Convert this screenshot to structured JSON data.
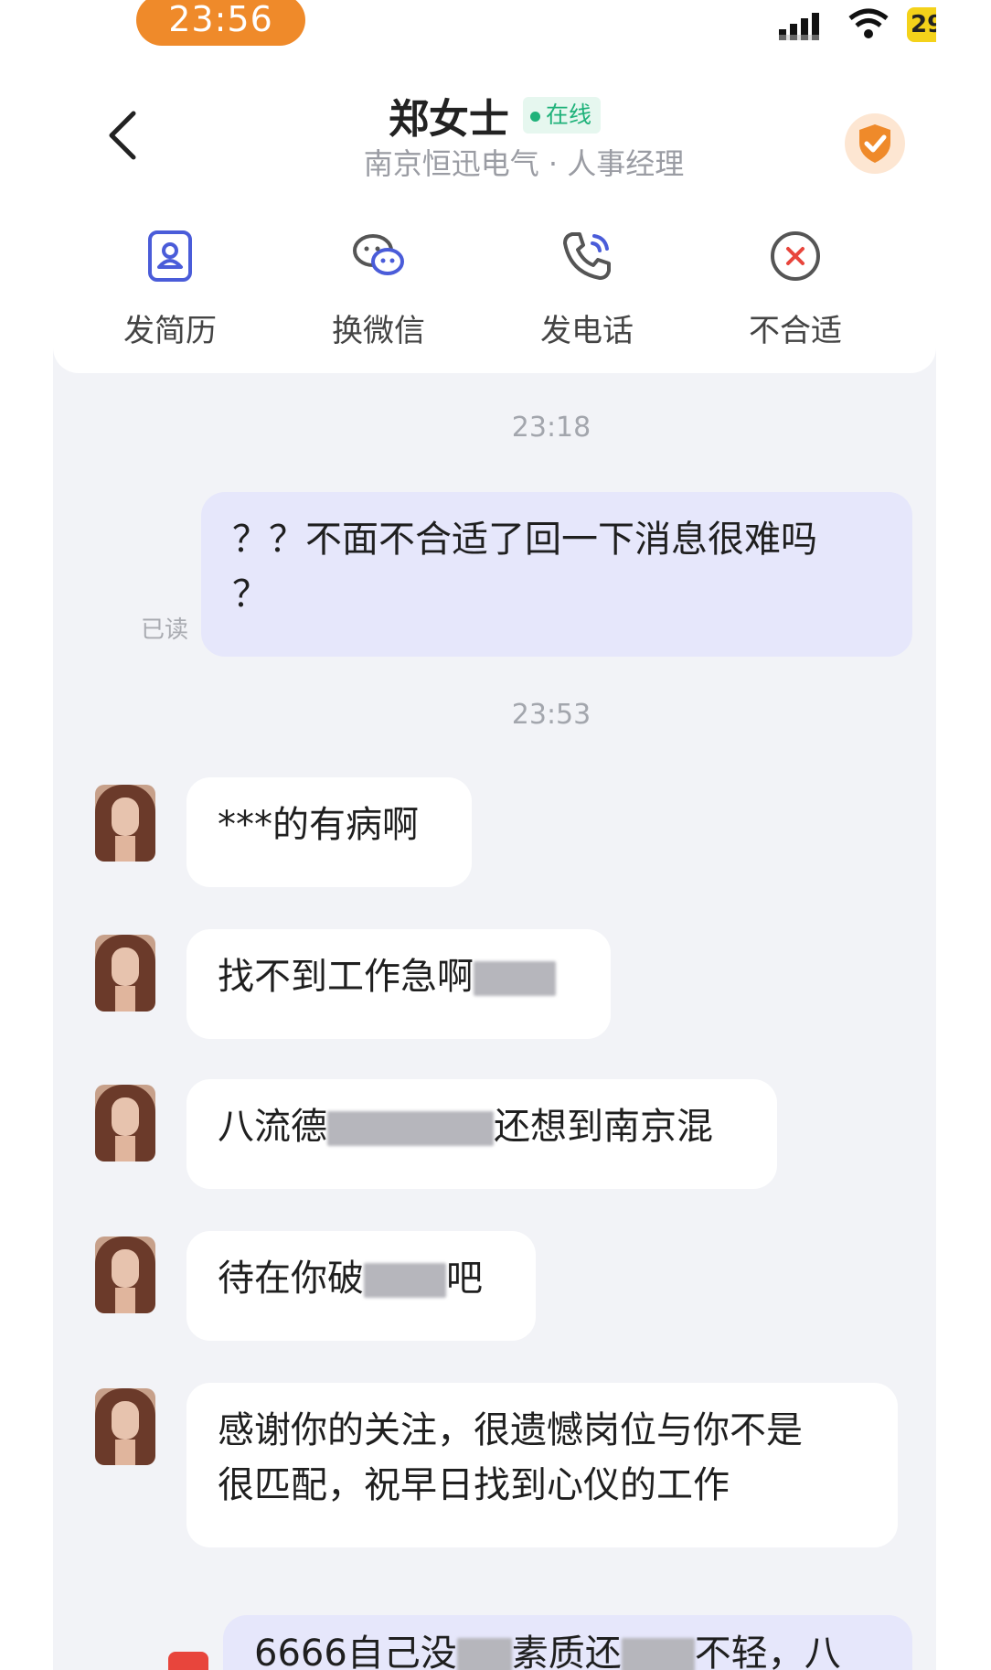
{
  "status_bar": {
    "time": "23:56",
    "battery": "29"
  },
  "header": {
    "contact_name": "郑女士",
    "online_status": "在线",
    "subtitle": "南京恒迅电气 · 人事经理"
  },
  "actions": [
    {
      "label": "发简历",
      "icon": "resume-icon"
    },
    {
      "label": "换微信",
      "icon": "wechat-icon"
    },
    {
      "label": "发电话",
      "icon": "phone-icon"
    },
    {
      "label": "不合适",
      "icon": "reject-icon"
    }
  ],
  "chat": {
    "timestamp_1": "23:18",
    "read_status": "已读",
    "my_message_1_line1": "？？不面不合适了回一下消息很难吗",
    "my_message_1_line2": "？",
    "timestamp_2": "23:53",
    "their_messages": [
      {
        "text": "***的有病啊"
      },
      {
        "pre": "找不到工作急啊"
      },
      {
        "pre": "八流德",
        "post": "还想到南京混"
      },
      {
        "pre": "待在你破",
        "post": "吧"
      },
      {
        "line1": "感谢你的关注，很遗憾岗位与你不是",
        "line2": "很匹配，祝早日找到心仪的工作"
      }
    ],
    "my_message_2": {
      "part1": "6666自己没",
      "part2": "素质还",
      "part3": "不轻，八"
    }
  },
  "colors": {
    "accent": "#ef8a2a",
    "online_green": "#1fb27a",
    "my_bubble": "#e6e7fb",
    "background": "#f2f3f7"
  }
}
